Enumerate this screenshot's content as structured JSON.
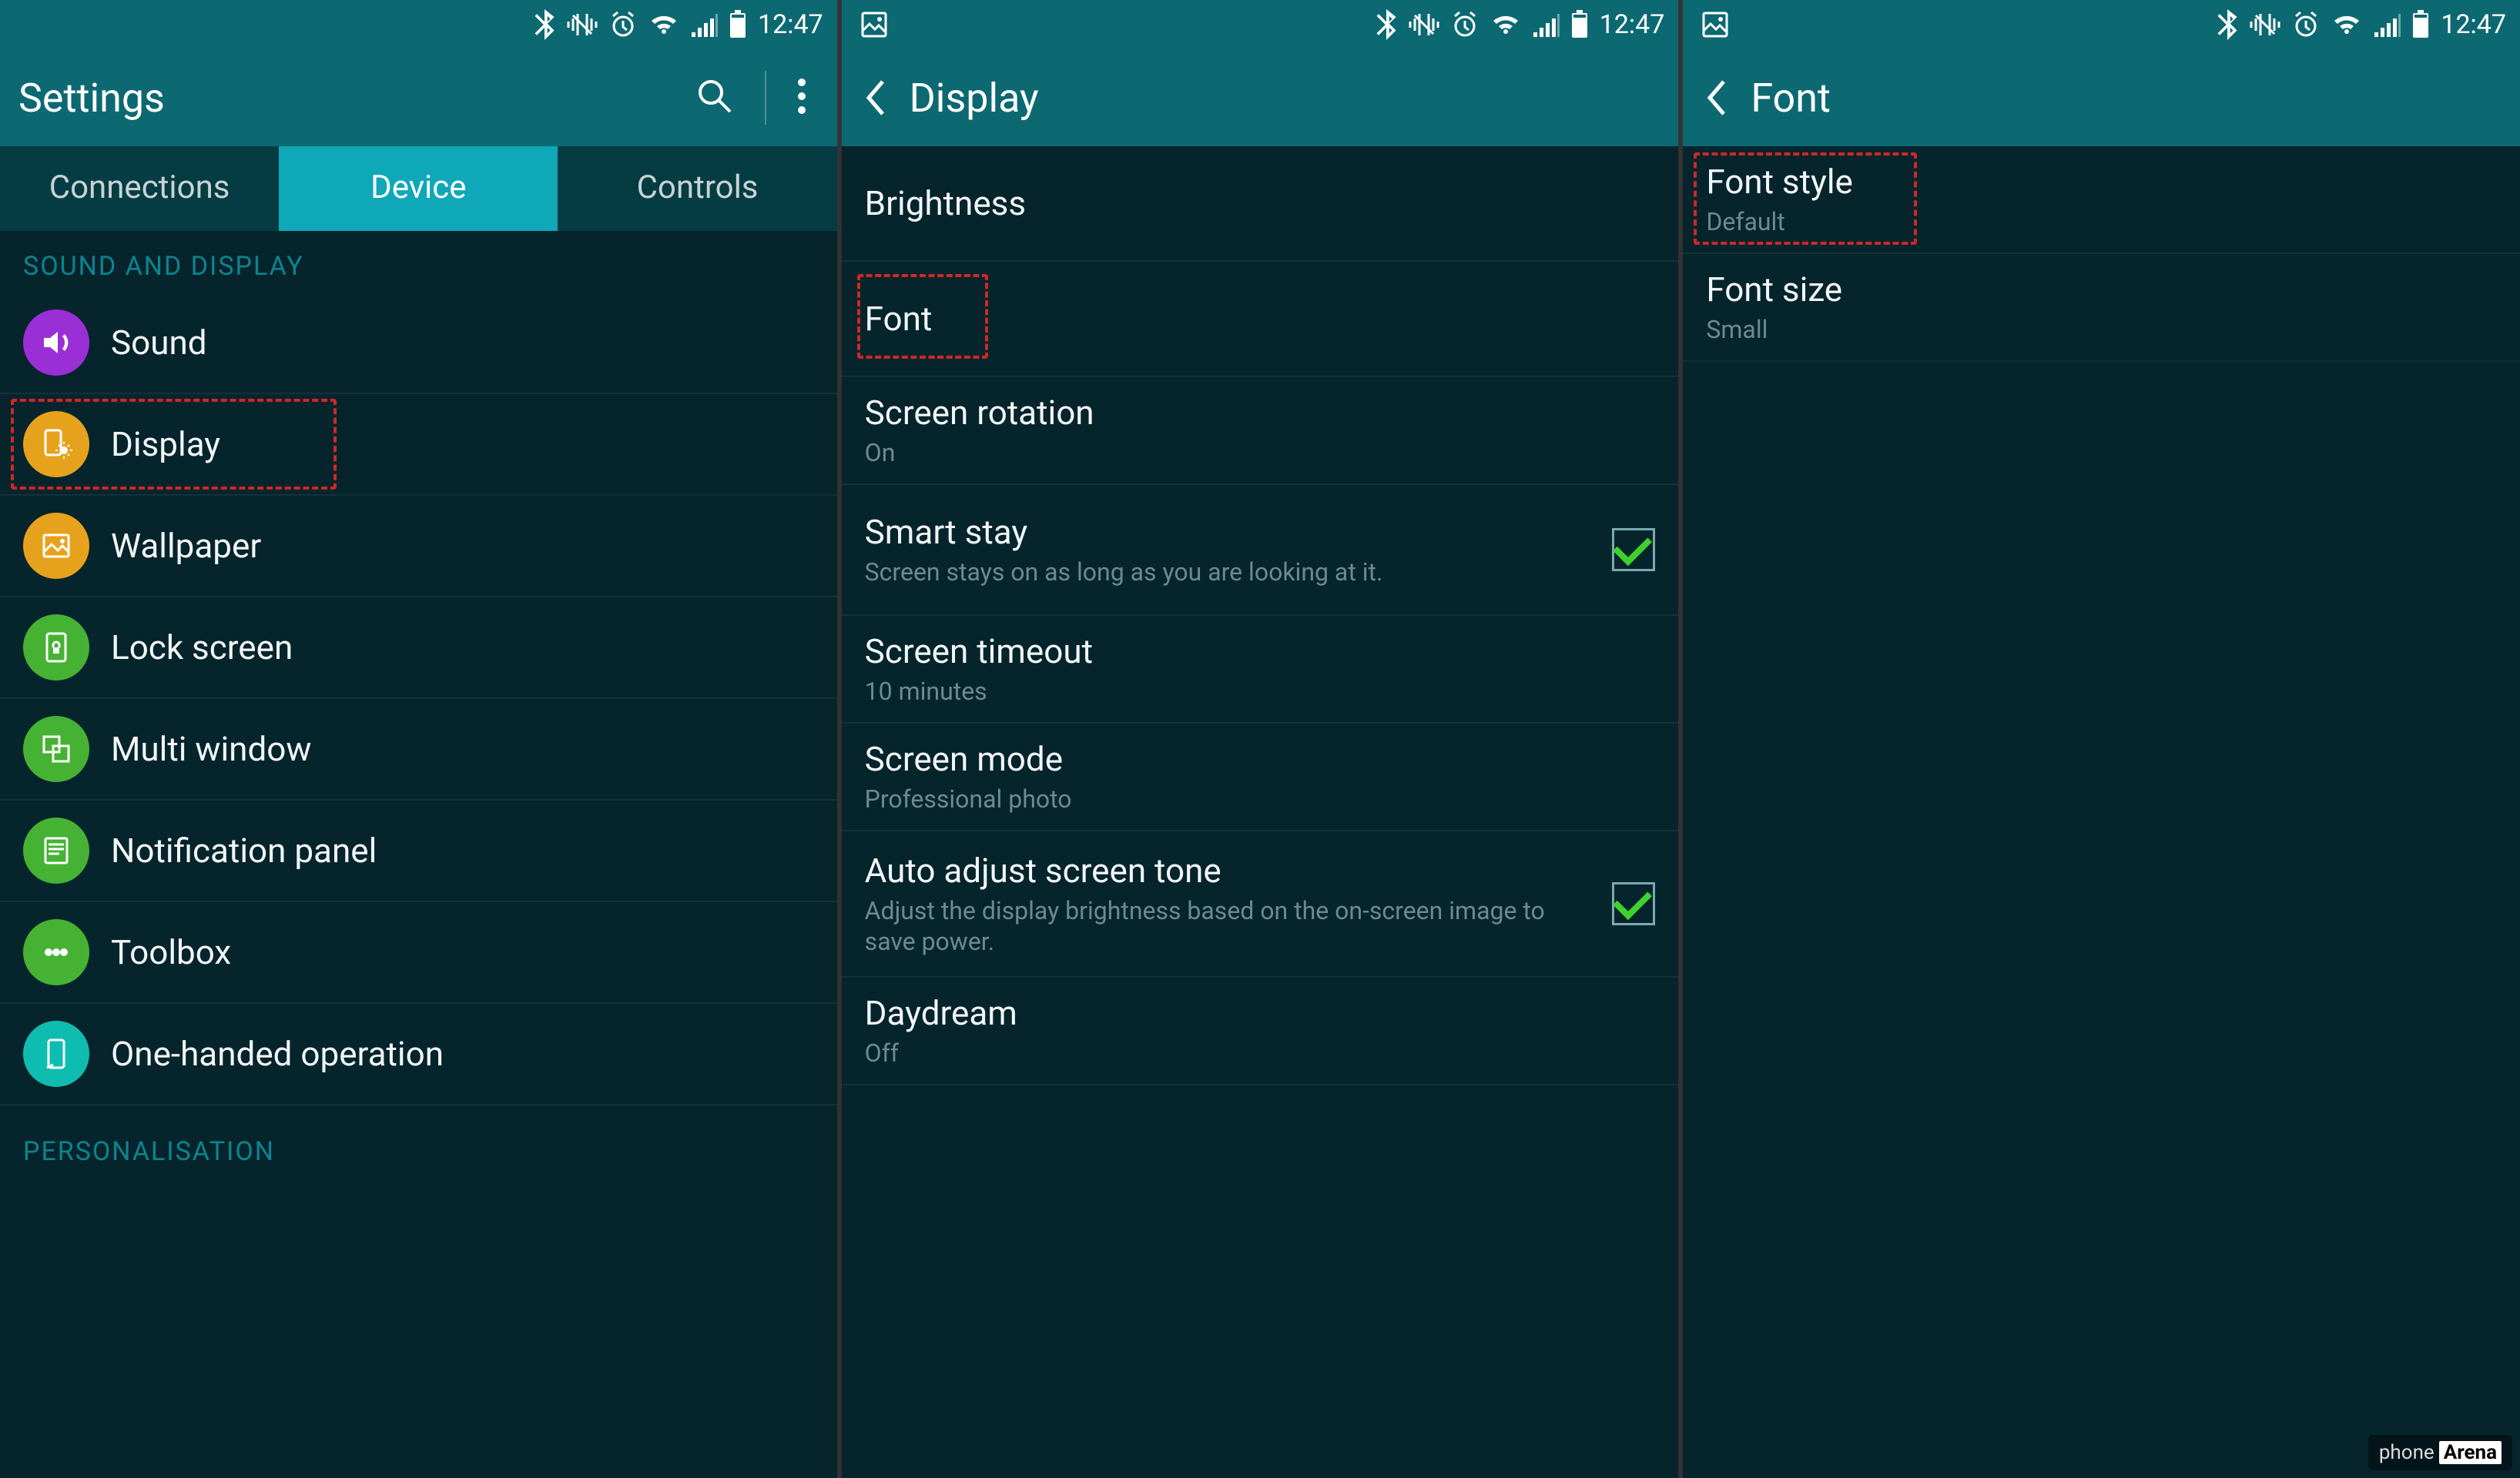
{
  "status": {
    "time": "12:47"
  },
  "screen1": {
    "appbar": {
      "title": "Settings"
    },
    "tabs": [
      "Connections",
      "Device",
      "Controls"
    ],
    "active_tab": 1,
    "section1": "SOUND AND DISPLAY",
    "items": [
      {
        "label": "Sound"
      },
      {
        "label": "Display"
      },
      {
        "label": "Wallpaper"
      },
      {
        "label": "Lock screen"
      },
      {
        "label": "Multi window"
      },
      {
        "label": "Notification panel"
      },
      {
        "label": "Toolbox"
      },
      {
        "label": "One-handed operation"
      }
    ],
    "section2": "PERSONALISATION"
  },
  "screen2": {
    "appbar": {
      "title": "Display"
    },
    "items": [
      {
        "label": "Brightness"
      },
      {
        "label": "Font"
      },
      {
        "label": "Screen rotation",
        "sub": "On"
      },
      {
        "label": "Smart stay",
        "sub": "Screen stays on as long as you are looking at it.",
        "checked": true
      },
      {
        "label": "Screen timeout",
        "sub": "10 minutes"
      },
      {
        "label": "Screen mode",
        "sub": "Professional photo"
      },
      {
        "label": "Auto adjust screen tone",
        "sub": "Adjust the display brightness based on the on-screen image to save power.",
        "checked": true
      },
      {
        "label": "Daydream",
        "sub": "Off"
      }
    ]
  },
  "screen3": {
    "appbar": {
      "title": "Font"
    },
    "items": [
      {
        "label": "Font style",
        "sub": "Default"
      },
      {
        "label": "Font size",
        "sub": "Small"
      }
    ]
  },
  "watermark": {
    "a": "phone",
    "b": "Arena"
  }
}
